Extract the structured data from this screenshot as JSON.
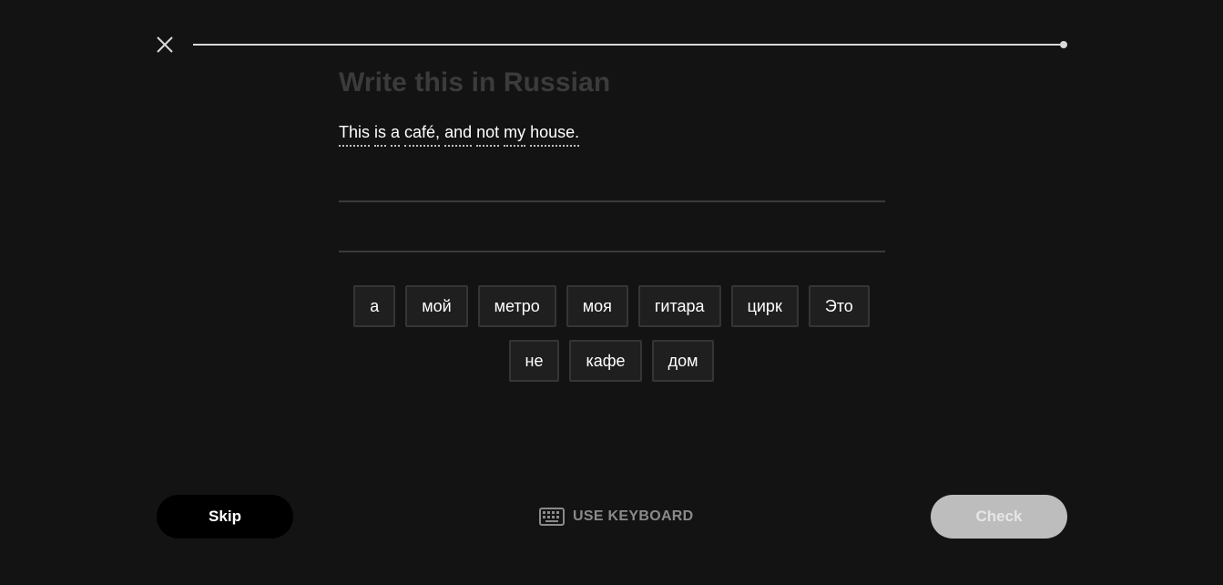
{
  "header": {
    "close_icon": "close-icon",
    "progress": 1.0
  },
  "prompt": {
    "heading": "Write this in Russian",
    "sentence_words": [
      "This",
      "is",
      "a",
      "café,",
      "and",
      "not",
      "my",
      "house."
    ]
  },
  "word_bank": {
    "row1": [
      "а",
      "мой",
      "метро",
      "моя",
      "гитара",
      "цирк",
      "Это"
    ],
    "row2": [
      "не",
      "кафе",
      "дом"
    ]
  },
  "footer": {
    "skip_label": "Skip",
    "keyboard_label": "USE KEYBOARD",
    "keyboard_icon": "keyboard-icon",
    "check_label": "Check"
  },
  "colors": {
    "background": "#131313",
    "chip_bg": "#1f1f1f",
    "check_disabled": "#bdbdbd"
  }
}
